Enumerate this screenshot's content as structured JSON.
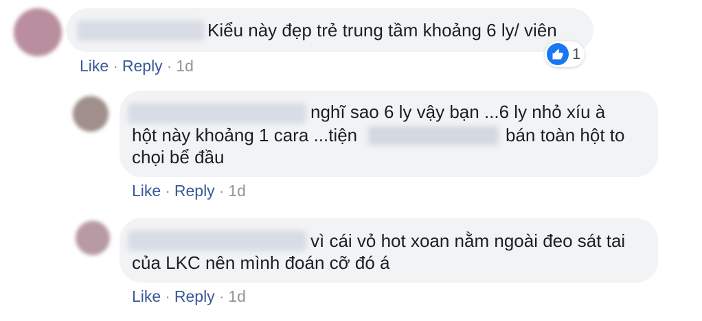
{
  "comments": [
    {
      "lines": [
        "Kiểu này đẹp trẻ trung tầm khoảng 6 ly/ viên"
      ],
      "like": "Like",
      "reply": "Reply",
      "time": "1d",
      "reaction_count": "1"
    },
    {
      "lines": [
        "nghĩ sao 6 ly vậy bạn ...6 ly nhỏ xíu à",
        "hột này khoảng 1 cara ...tiện",
        "bán toàn hột to",
        "chọi bể đầu"
      ],
      "like": "Like",
      "reply": "Reply",
      "time": "1d"
    },
    {
      "lines": [
        "vì cái vỏ hot xoan nằm ngoài đeo sát tai",
        "của LKC nên mình đoán cỡ đó á"
      ],
      "like": "Like",
      "reply": "Reply",
      "time": "1d"
    }
  ],
  "separator": "·",
  "colors": {
    "bubble": "#f2f3f5",
    "link": "#385898",
    "meta": "#90949c",
    "like_blue": "#1877f2"
  },
  "icons": {
    "reaction": "thumbs-up-icon"
  }
}
